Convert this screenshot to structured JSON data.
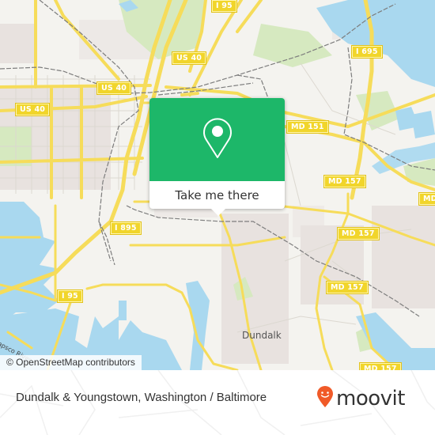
{
  "map": {
    "type": "street-map",
    "colors": {
      "land": "#f4f3ef",
      "water": "#a9d8ef",
      "park": "#d6e9c0",
      "road_major": "#f6dc5a",
      "road_minor": "#d8d4cc",
      "rail": "#7d7d7d",
      "urban": "#e8e2df"
    },
    "shields": [
      {
        "label": "I 95",
        "id": "i95-north"
      },
      {
        "label": "US 40",
        "id": "us40-center"
      },
      {
        "label": "US 40",
        "id": "us40-mid"
      },
      {
        "label": "US 40",
        "id": "us40-west"
      },
      {
        "label": "I 695",
        "id": "i695"
      },
      {
        "label": "MD 151",
        "id": "md151"
      },
      {
        "label": "MD 157",
        "id": "md157-a"
      },
      {
        "label": "MD 157",
        "id": "md157-b"
      },
      {
        "label": "MD 157",
        "id": "md157-c"
      },
      {
        "label": "MD 157",
        "id": "md157-d"
      },
      {
        "label": "MD 157",
        "id": "md157-e"
      },
      {
        "label": "I 895",
        "id": "i895"
      },
      {
        "label": "I 95",
        "id": "i95-south"
      },
      {
        "label": "MD",
        "id": "md-east-partial"
      }
    ],
    "places": [
      {
        "label": "Dundalk",
        "id": "dundalk"
      }
    ],
    "water_labels": [
      {
        "label": "Patapsco River",
        "visible_text": "apsco River",
        "id": "patapsco"
      }
    ],
    "attribution": "© OpenStreetMap contributors"
  },
  "popup": {
    "icon": "map-pin-icon",
    "button_label": "Take me there",
    "accent": "#1db769"
  },
  "footer": {
    "title": "Dundalk & Youngstown, Washington / Baltimore",
    "logo_text": "moovit",
    "logo_accent": "#f05a28"
  }
}
